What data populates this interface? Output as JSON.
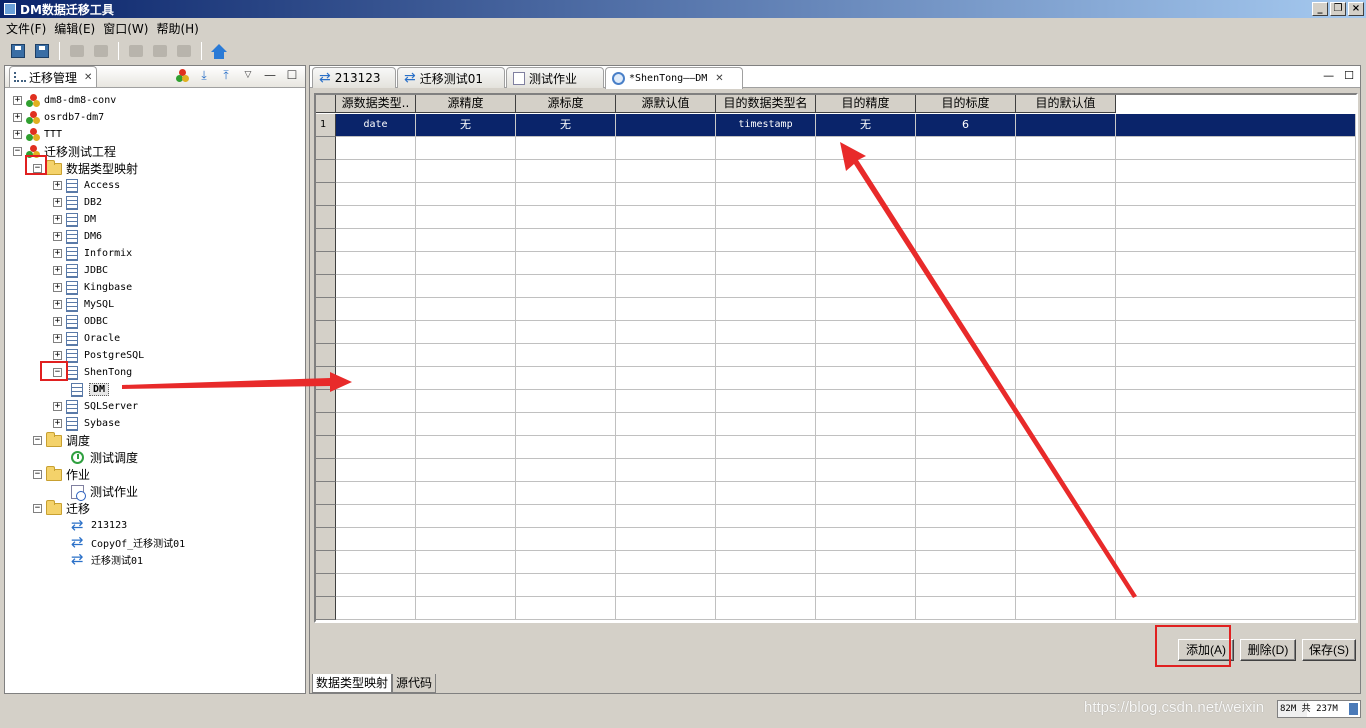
{
  "window": {
    "title": "DM数据迁移工具",
    "controls": [
      "_",
      "❐",
      "×"
    ]
  },
  "menu": [
    "文件(F)",
    "编辑(E)",
    "窗口(W)",
    "帮助(H)"
  ],
  "left_view": {
    "tab_label": "迁移管理"
  },
  "tree": {
    "projects": [
      "dm8-dm8-conv",
      "osrdb7-dm7",
      "TTT"
    ],
    "current_project": "迁移测试工程",
    "folder_mapping": "数据类型映射",
    "mapping_items": [
      "Access",
      "DB2",
      "DM",
      "DM6",
      "Informix",
      "JDBC",
      "Kingbase",
      "MySQL",
      "ODBC",
      "Oracle",
      "PostgreSQL",
      "ShenTong",
      "SQLServer",
      "Sybase"
    ],
    "shentong_child": "DM",
    "folder_schedule": "调度",
    "schedule_item": "测试调度",
    "folder_job": "作业",
    "job_item": "测试作业",
    "folder_migration": "迁移",
    "migration_items": [
      "213123",
      "CopyOf_迁移测试01",
      "迁移测试01"
    ]
  },
  "editor_tabs": [
    "213123",
    "迁移测试01",
    "测试作业",
    "*ShenTong——DM"
  ],
  "grid": {
    "columns": [
      "源数据类型..",
      "源精度",
      "源标度",
      "源默认值",
      "目的数据类型名",
      "目的精度",
      "目的标度",
      "目的默认值"
    ],
    "rows": [
      {
        "num": "1",
        "cells": [
          "date",
          "无",
          "无",
          "",
          "timestamp",
          "无",
          "6",
          ""
        ]
      }
    ],
    "empty_row_count": 21
  },
  "buttons": {
    "add": "添加(A)",
    "delete": "删除(D)",
    "save": "保存(S)"
  },
  "bottom_tabs": [
    "数据类型映射",
    "源代码"
  ],
  "status": {
    "memory": "82M 共 237M",
    "memory_fraction": 0.346,
    "watermark": "https://blog.csdn.net/weixin"
  },
  "colors": {
    "selection": "#0a246a",
    "annotation": "#e02020"
  }
}
